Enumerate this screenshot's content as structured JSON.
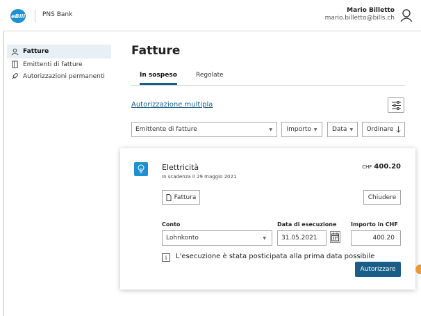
{
  "header": {
    "logo_text": "eBill",
    "bank_name": "PNS Bank",
    "user_name": "Mario Billetto",
    "user_email": "mario.billetto@bills.ch"
  },
  "sidebar": {
    "items": [
      {
        "label": "Fatture",
        "icon": "invoice-icon",
        "active": true
      },
      {
        "label": "Emittenti di fatture",
        "icon": "building-icon",
        "active": false
      },
      {
        "label": "Autorizzazioni permanenti",
        "icon": "rocket-icon",
        "active": false
      }
    ]
  },
  "main": {
    "title": "Fatture",
    "tabs": [
      {
        "label": "In sospeso",
        "active": true
      },
      {
        "label": "Regolate",
        "active": false
      }
    ],
    "multi_auth_link": "Autorizzazione multipla",
    "filters": {
      "issuer_placeholder": "Emittente di fatture",
      "amount_label": "Importo",
      "date_label": "Data",
      "order_label": "Ordinare"
    }
  },
  "card": {
    "title": "Elettricità",
    "due": "In scadenza il 29 maggio 2021",
    "currency": "CHF",
    "amount": "400.20",
    "invoice_button": "Fattura",
    "close_button": "Chiudere",
    "account_label": "Conto",
    "account_value": "Lohnkonto",
    "date_label": "Data di esecuzione",
    "date_value": "31.05.2021",
    "amount_label": "Importo in CHF",
    "amount_value": "400.20",
    "info_icon_text": "i",
    "info_text": "L'esecuzione è stata posticipata alla prima data possibile",
    "authorize_button": "Autorizzare"
  },
  "colors": {
    "accent": "#1a5d86",
    "logo": "#1e8fd1",
    "sidebar_active": "#e6f0f5"
  }
}
